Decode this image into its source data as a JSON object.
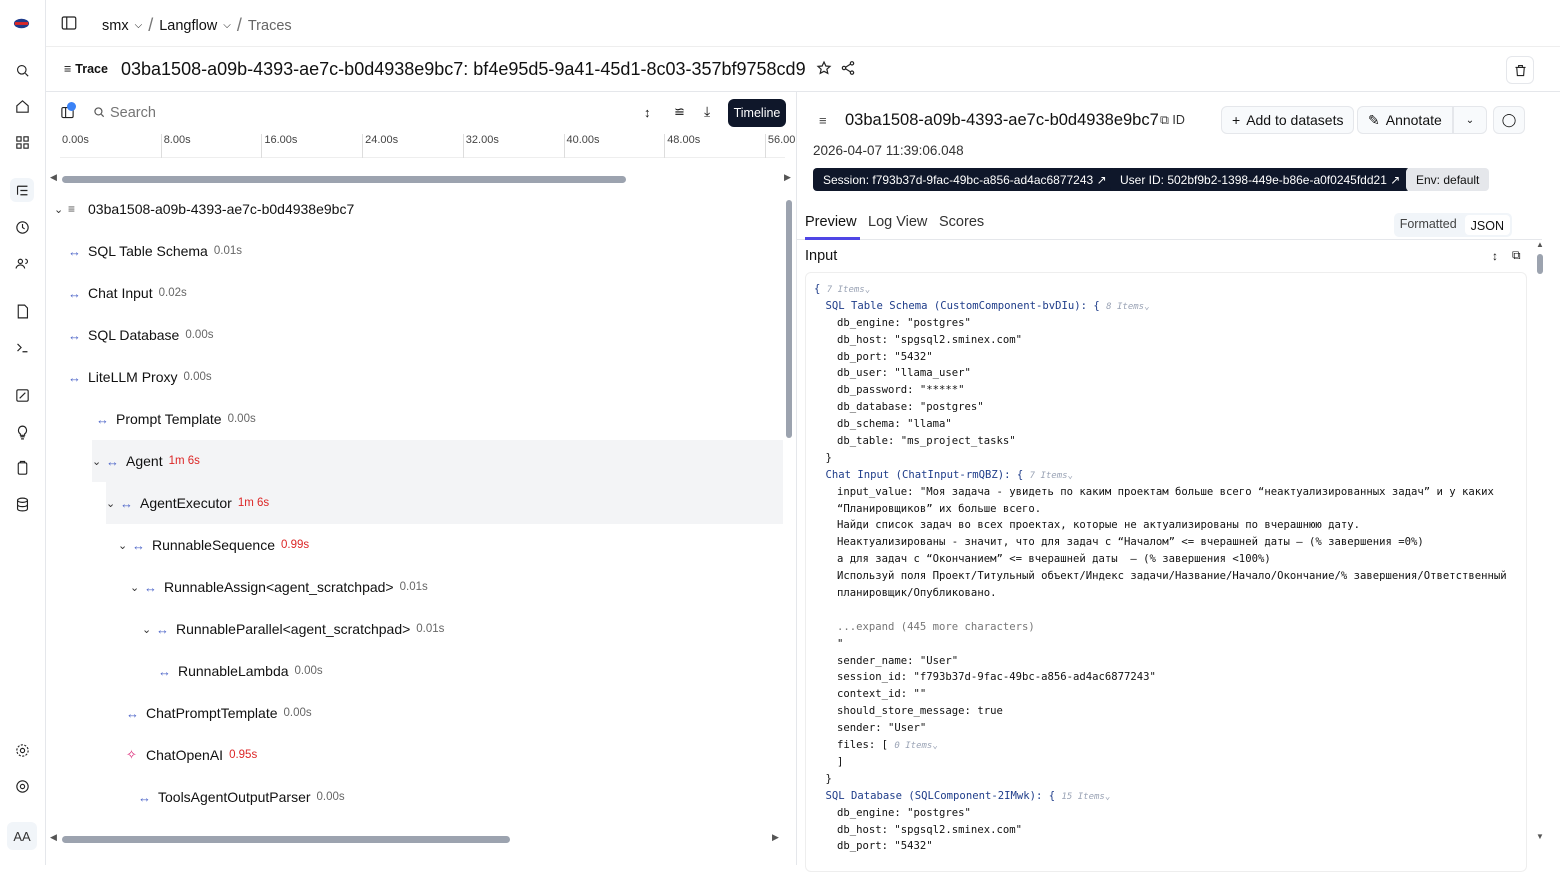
{
  "breadcrumb": {
    "workspace": "smx",
    "project": "Langflow",
    "page": "Traces"
  },
  "header": {
    "badge": "Trace",
    "title": "03ba1508-a09b-4393-ae7c-b0d4938e9bc7: bf4e95d5-9a41-45d1-8c03-357bf9758cd9"
  },
  "search": {
    "placeholder": "Search"
  },
  "timeline_label": "Timeline",
  "ruler": [
    "0.00s",
    "8.00s",
    "16.00s",
    "24.00s",
    "32.00s",
    "40.00s",
    "48.00s",
    "56.00"
  ],
  "tree": {
    "root": "03ba1508-a09b-4393-ae7c-b0d4938e9bc7",
    "rows": [
      {
        "name": "SQL Table Schema",
        "dur": "0.01s",
        "red": false
      },
      {
        "name": "Chat Input",
        "dur": "0.02s",
        "red": false
      },
      {
        "name": "SQL Database",
        "dur": "0.00s",
        "red": false
      },
      {
        "name": "LiteLLM Proxy",
        "dur": "0.00s",
        "red": false
      },
      {
        "name": "Prompt Template",
        "dur": "0.00s",
        "red": false
      },
      {
        "name": "Agent",
        "dur": "1m 6s",
        "red": true
      },
      {
        "name": "AgentExecutor",
        "dur": "1m 6s",
        "red": true
      },
      {
        "name": "RunnableSequence",
        "dur": "0.99s",
        "red": true
      },
      {
        "name": "RunnableAssign<agent_scratchpad>",
        "dur": "0.01s",
        "red": false
      },
      {
        "name": "RunnableParallel<agent_scratchpad>",
        "dur": "0.01s",
        "red": false
      },
      {
        "name": "RunnableLambda",
        "dur": "0.00s",
        "red": false
      },
      {
        "name": "ChatPromptTemplate",
        "dur": "0.00s",
        "red": false
      },
      {
        "name": "ChatOpenAI",
        "dur": "0.95s",
        "red": true
      },
      {
        "name": "ToolsAgentOutputParser",
        "dur": "0.00s",
        "red": false
      }
    ]
  },
  "detail": {
    "title": "03ba1508-a09b-4393-ae7c-b0d4938e9bc7",
    "id_label": "ID",
    "add_label": "Add to datasets",
    "annotate_label": "Annotate",
    "date": "2026-04-07 11:39:06.048",
    "session": "Session: f793b37d-9fac-49bc-a856-ad4ac6877243",
    "user": "User ID: 502bf9b2-1398-449e-b86e-a0f0245fdd21",
    "env": "Env: default",
    "tabs": [
      "Preview",
      "Log View",
      "Scores"
    ],
    "format": [
      "Formatted",
      "JSON"
    ],
    "input_label": "Input"
  },
  "json_lines": [
    {
      "i": 0,
      "t": "{ ",
      "c": "7 Items"
    },
    {
      "i": 1,
      "t": "SQL Table Schema (CustomComponent-bvDIu): { ",
      "c": "8 Items"
    },
    {
      "i": 2,
      "t": "db_engine: \"postgres\""
    },
    {
      "i": 2,
      "t": "db_host: \"spgsql2.sminex.com\""
    },
    {
      "i": 2,
      "t": "db_port: \"5432\""
    },
    {
      "i": 2,
      "t": "db_user: \"llama_user\""
    },
    {
      "i": 2,
      "t": "db_password: \"*****\""
    },
    {
      "i": 2,
      "t": "db_database: \"postgres\""
    },
    {
      "i": 2,
      "t": "db_schema: \"llama\""
    },
    {
      "i": 2,
      "t": "db_table: \"ms_project_tasks\""
    },
    {
      "i": 1,
      "t": "}"
    },
    {
      "i": 1,
      "t": "Chat Input (ChatInput-rmQBZ): { ",
      "c": "7 Items"
    },
    {
      "i": 2,
      "t": "input_value: \"Моя задача - увидеть по каким проектам больше всего “неактуализированных задач” и у каких"
    },
    {
      "i": 2,
      "t": "“Планировщиков” их больше всего."
    },
    {
      "i": 2,
      "t": "Найди список задач во всех проектах, которые не актуализированы по вчерашнюю дату."
    },
    {
      "i": 2,
      "t": "Неактуализированы - значит, что для задач с “Началом” <= вчерашней даты – (% завершения =0%)"
    },
    {
      "i": 2,
      "t": "а для задач с “Окончанием” <= вчерашней даты  – (% завершения <100%)"
    },
    {
      "i": 2,
      "t": "Используй поля Проект/Титульный объект/Индекс задачи/Название/Начало/Окончание/% завершения/Ответственный"
    },
    {
      "i": 2,
      "t": "планировщик/Опубликовано."
    },
    {
      "i": 2,
      "t": ""
    },
    {
      "i": 2,
      "t": "...expand (445 more characters)",
      "g": true
    },
    {
      "i": 2,
      "t": "\""
    },
    {
      "i": 2,
      "t": "sender_name: \"User\""
    },
    {
      "i": 2,
      "t": "session_id: \"f793b37d-9fac-49bc-a856-ad4ac6877243\""
    },
    {
      "i": 2,
      "t": "context_id: \"\""
    },
    {
      "i": 2,
      "t": "should_store_message: true"
    },
    {
      "i": 2,
      "t": "sender: \"User\""
    },
    {
      "i": 2,
      "t": "files: [ ",
      "c": "0 Items"
    },
    {
      "i": 2,
      "t": "]"
    },
    {
      "i": 1,
      "t": "}"
    },
    {
      "i": 1,
      "t": "SQL Database (SQLComponent-2IMwk): { ",
      "c": "15 Items"
    },
    {
      "i": 2,
      "t": "db_engine: \"postgres\""
    },
    {
      "i": 2,
      "t": "db_host: \"spgsql2.sminex.com\""
    },
    {
      "i": 2,
      "t": "db_port: \"5432\""
    }
  ],
  "rail_icons": [
    "search-icon",
    "home-icon",
    "dashboard-icon",
    "traces-icon",
    "sessions-icon",
    "users-icon",
    "prompts-icon",
    "playground-icon",
    "scores-icon",
    "lightbulb-icon",
    "annotation-icon",
    "datasets-icon",
    "settings-icon",
    "support-icon"
  ],
  "avatar": "AA"
}
